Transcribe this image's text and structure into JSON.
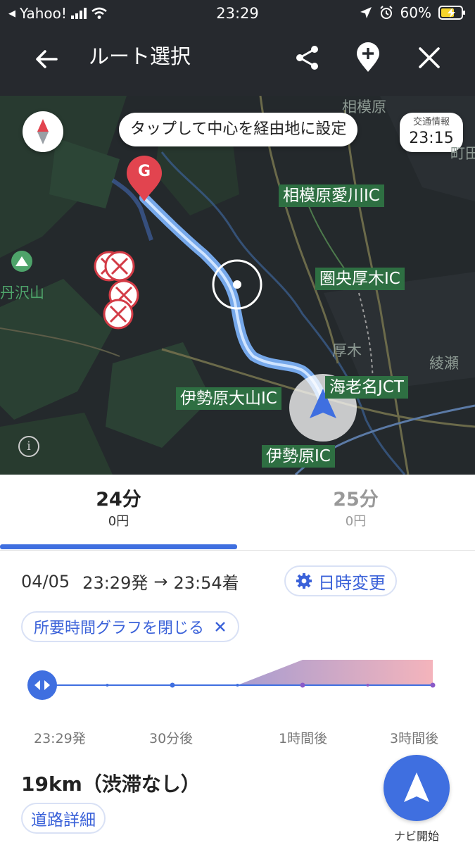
{
  "status_bar": {
    "carrier": "Yahoo!",
    "time": "23:29",
    "battery": "60%"
  },
  "header": {
    "title": "ルート選択",
    "icons": [
      "back-arrow-icon",
      "share-icon",
      "add-pin-icon",
      "close-icon"
    ]
  },
  "map": {
    "hint": "タップして中心を経由地に設定",
    "traffic": {
      "label": "交通情報",
      "time": "23:15"
    },
    "goal_marker": "G",
    "interchange_labels": [
      "相模原愛川IC",
      "圏央厚木IC",
      "伊勢原大山IC",
      "海老名JCT",
      "伊勢原IC"
    ],
    "place_labels": [
      "相模原",
      "厚木",
      "綾瀬",
      "丹沢山",
      "町田"
    ]
  },
  "routes": [
    {
      "duration": "24分",
      "toll": "0円",
      "selected": true
    },
    {
      "duration": "25分",
      "toll": "0円",
      "selected": false
    }
  ],
  "schedule": {
    "date": "04/05",
    "depart": "23:29発",
    "arrow": "→",
    "arrive": "23:54着",
    "change_button": "日時変更"
  },
  "graph": {
    "toggle_label": "所要時間グラフを閉じる",
    "tick_labels": [
      "23:29発",
      "30分後",
      "1時間後",
      "3時間後"
    ],
    "congestion_fraction": [
      0,
      0,
      0,
      0,
      0.45,
      0.45,
      0.45
    ]
  },
  "summary": {
    "distance": "19km（渋滞なし）",
    "road_detail": "道路詳細",
    "navi_start": "ナビ開始"
  },
  "colors": {
    "accent": "#3f6fe0",
    "header_bg": "#26292e",
    "route_line": "#7fb6ff",
    "ic_label_bg": "#2e6f42",
    "graph_fill": "#f2a7b0"
  }
}
